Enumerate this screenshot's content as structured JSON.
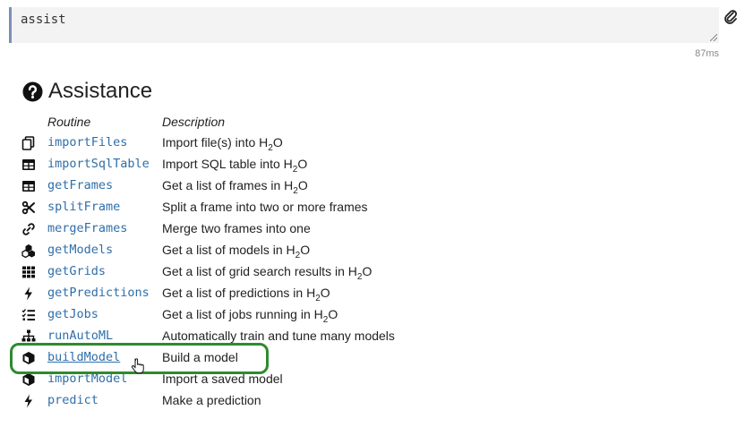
{
  "input": {
    "code": "assist"
  },
  "timing": "87ms",
  "assistance": {
    "title": "Assistance",
    "headers": {
      "routine": "Routine",
      "description": "Description"
    },
    "routines": [
      {
        "name": "importFiles",
        "icon": "files-icon",
        "desc_pre": "Import file(s) into H",
        "desc_sub": "2",
        "desc_post": "O"
      },
      {
        "name": "importSqlTable",
        "icon": "table-icon",
        "desc_pre": "Import SQL table into H",
        "desc_sub": "2",
        "desc_post": "O"
      },
      {
        "name": "getFrames",
        "icon": "table-icon",
        "desc_pre": "Get a list of frames in H",
        "desc_sub": "2",
        "desc_post": "O"
      },
      {
        "name": "splitFrame",
        "icon": "scissors-icon",
        "desc_pre": "Split a frame into two or more frames",
        "desc_sub": "",
        "desc_post": ""
      },
      {
        "name": "mergeFrames",
        "icon": "link-icon",
        "desc_pre": "Merge two frames into one",
        "desc_sub": "",
        "desc_post": ""
      },
      {
        "name": "getModels",
        "icon": "cubes-icon",
        "desc_pre": "Get a list of models in H",
        "desc_sub": "2",
        "desc_post": "O"
      },
      {
        "name": "getGrids",
        "icon": "grid-icon",
        "desc_pre": "Get a list of grid search results in H",
        "desc_sub": "2",
        "desc_post": "O"
      },
      {
        "name": "getPredictions",
        "icon": "bolt-icon",
        "desc_pre": "Get a list of predictions in H",
        "desc_sub": "2",
        "desc_post": "O"
      },
      {
        "name": "getJobs",
        "icon": "tasks-icon",
        "desc_pre": "Get a list of jobs running in H",
        "desc_sub": "2",
        "desc_post": "O"
      },
      {
        "name": "runAutoML",
        "icon": "sitemap-icon",
        "desc_pre": "Automatically train and tune many models",
        "desc_sub": "",
        "desc_post": ""
      },
      {
        "name": "buildModel",
        "icon": "cube-icon",
        "desc_pre": "Build a model",
        "desc_sub": "",
        "desc_post": ""
      },
      {
        "name": "importModel",
        "icon": "cube-icon",
        "desc_pre": "Import a saved model",
        "desc_sub": "",
        "desc_post": ""
      },
      {
        "name": "predict",
        "icon": "bolt-icon",
        "desc_pre": "Make a prediction",
        "desc_sub": "",
        "desc_post": ""
      }
    ]
  },
  "colors": {
    "link": "#2f6ea9",
    "highlight": "#2e8b2e",
    "input_border": "#7a8fb8"
  }
}
